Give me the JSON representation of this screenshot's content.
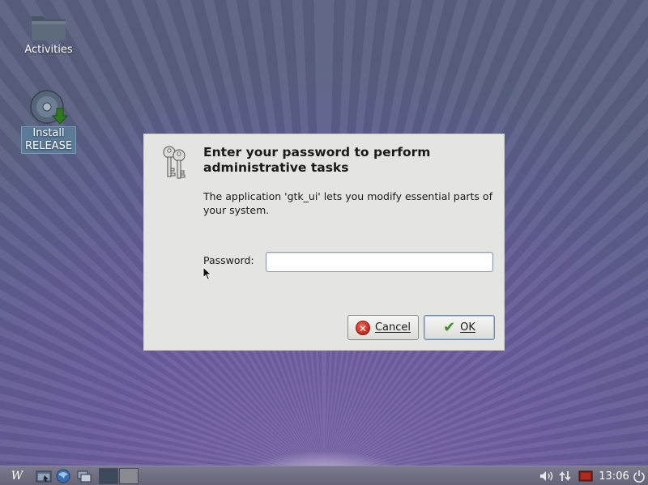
{
  "desktop": {
    "icons": [
      {
        "label": "Activities",
        "icon": "folder-icon"
      },
      {
        "label": "Install\nRELEASE",
        "label_line1": "Install",
        "label_line2": "RELEASE",
        "icon": "disc-install-icon"
      }
    ]
  },
  "dialog": {
    "title": "Enter your password to perform administrative tasks",
    "message": "The application 'gtk_ui' lets you modify essential parts of your system.",
    "password_label": "Password:",
    "password_value": "",
    "cancel_label": "Cancel",
    "cancel_mnemonic": "C",
    "ok_label": "OK",
    "ok_mnemonic": "O",
    "icon": "keys-icon"
  },
  "taskbar": {
    "menu_glyph": "W",
    "clock": "13:06",
    "tray_icons": [
      "volume-icon",
      "network-icon",
      "battery-icon",
      "power-icon"
    ],
    "launchers": [
      "file-manager-icon",
      "web-browser-icon",
      "window-switcher-icon"
    ]
  },
  "colors": {
    "desktop_bg": "#6b5b9c",
    "dialog_bg": "#e4e4e2",
    "taskbar_bg": "#6e6e80",
    "accent": "#3f8f1f",
    "danger": "#c3261a"
  }
}
